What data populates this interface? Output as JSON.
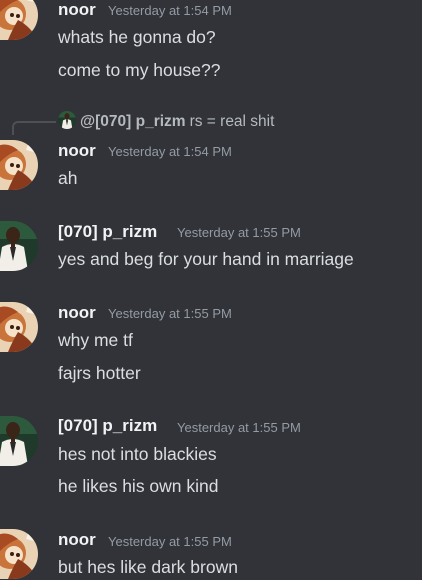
{
  "messages": [
    {
      "author": "noor",
      "timestamp": "Yesterday at 1:54 PM",
      "lines": [
        "whats he gonna do?",
        "come to my house??"
      ]
    },
    {
      "reply": {
        "author": "@[070] p_rizm",
        "text": "rs = real shit"
      },
      "author": "noor",
      "timestamp": "Yesterday at 1:54 PM",
      "lines": [
        "ah"
      ]
    },
    {
      "author": "[070] p_rizm",
      "timestamp": "Yesterday at 1:55 PM",
      "lines": [
        "yes and beg for your hand in marriage"
      ]
    },
    {
      "author": "noor",
      "timestamp": "Yesterday at 1:55 PM",
      "lines": [
        "why me tf",
        "fajrs hotter"
      ]
    },
    {
      "author": "[070] p_rizm",
      "timestamp": "Yesterday at 1:55 PM",
      "lines": [
        "hes not into blackies",
        "he likes his own kind"
      ]
    },
    {
      "author": "noor",
      "timestamp": "Yesterday at 1:55 PM",
      "lines": [
        "but hes like dark brown"
      ]
    }
  ],
  "avatars": {
    "noor": "anime-character-avatar",
    "p_rizm": "person-in-white-suit-avatar"
  },
  "colors": {
    "background": "#313338",
    "username": "#f2f3f5",
    "message_text": "#dbdee1",
    "timestamp": "#949ba4"
  }
}
